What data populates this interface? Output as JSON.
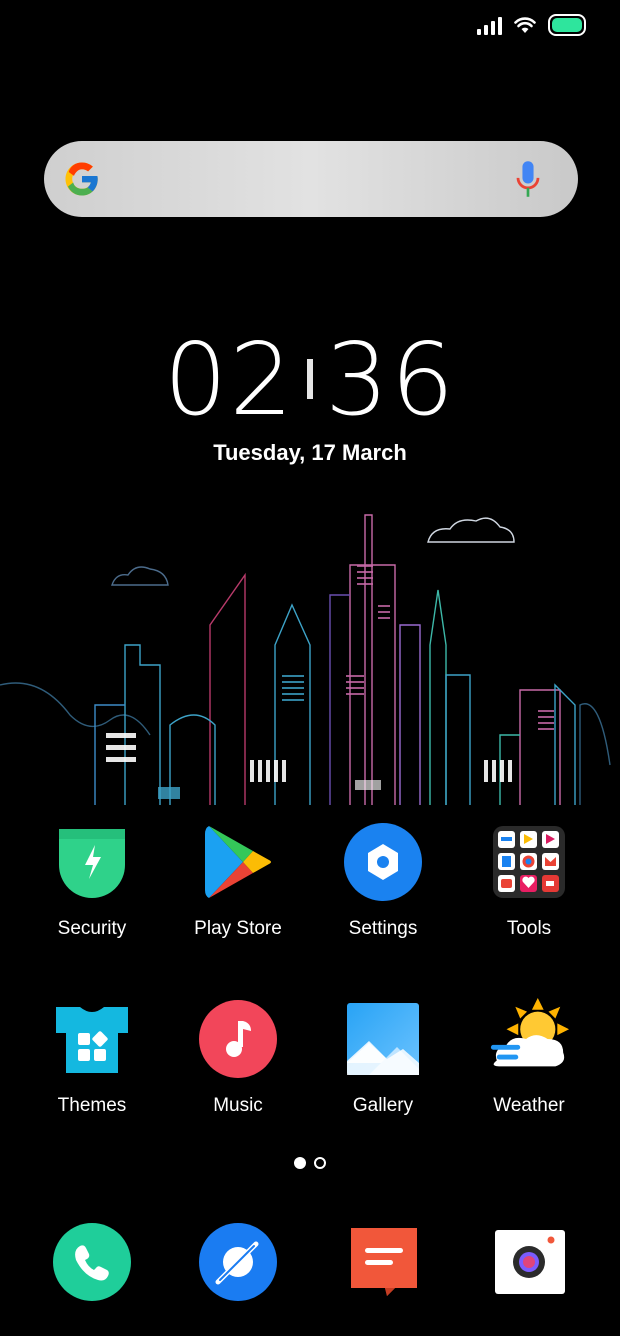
{
  "status_bar": {
    "icons": [
      "signal-icon",
      "wifi-icon",
      "battery-icon"
    ],
    "battery_color": "#2ee59d"
  },
  "search": {
    "icons": [
      "google-logo-icon",
      "microphone-icon"
    ]
  },
  "clock": {
    "hours": "02",
    "minutes": "36",
    "date": "Tuesday, 17 March"
  },
  "apps": [
    {
      "name": "security",
      "label": "Security",
      "icon": "shield-lightning-icon"
    },
    {
      "name": "play-store",
      "label": "Play Store",
      "icon": "play-store-icon"
    },
    {
      "name": "settings",
      "label": "Settings",
      "icon": "gear-icon"
    },
    {
      "name": "tools",
      "label": "Tools",
      "icon": "folder-icon"
    },
    {
      "name": "themes",
      "label": "Themes",
      "icon": "tshirt-icon"
    },
    {
      "name": "music",
      "label": "Music",
      "icon": "music-note-icon"
    },
    {
      "name": "gallery",
      "label": "Gallery",
      "icon": "mountain-image-icon"
    },
    {
      "name": "weather",
      "label": "Weather",
      "icon": "sun-cloud-icon"
    }
  ],
  "pager": {
    "pages": 2,
    "current": 1
  },
  "dock": [
    {
      "name": "phone",
      "icon": "phone-icon",
      "color": "#1fce9a"
    },
    {
      "name": "browser",
      "icon": "browser-icon",
      "color": "#1a7cf2"
    },
    {
      "name": "messages",
      "icon": "message-icon",
      "color": "#f1573a"
    },
    {
      "name": "camera",
      "icon": "camera-icon",
      "color": "#ffffff"
    }
  ]
}
